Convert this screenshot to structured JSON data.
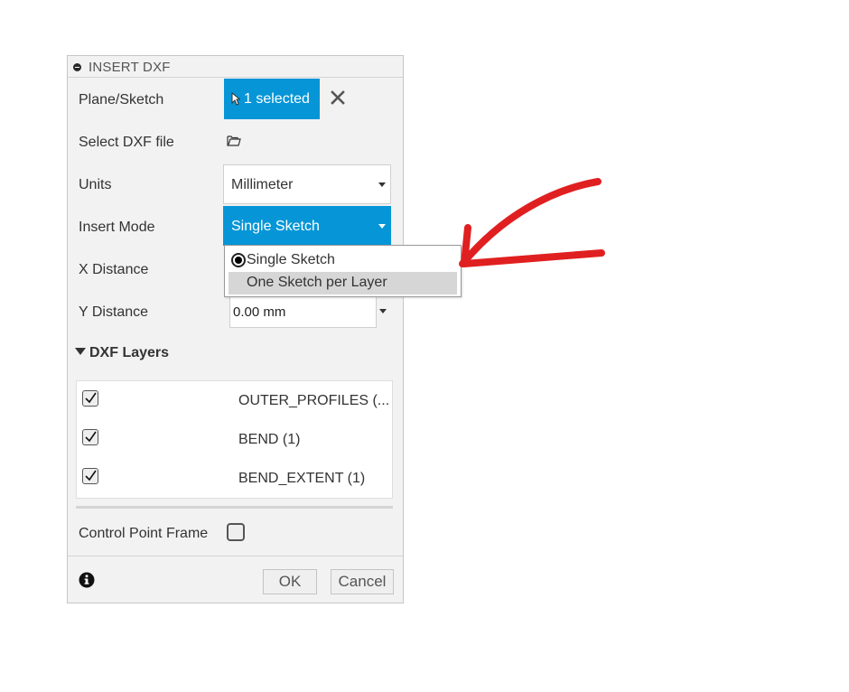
{
  "dialog": {
    "title": "INSERT DXF",
    "plane_sketch": {
      "label": "Plane/Sketch",
      "selection": "1 selected"
    },
    "dxf_file": {
      "label": "Select DXF file"
    },
    "units": {
      "label": "Units",
      "value": "Millimeter"
    },
    "insert_mode": {
      "label": "Insert Mode",
      "value": "Single Sketch",
      "options": [
        "Single Sketch",
        "One Sketch per Layer"
      ],
      "highlighted_option": "One Sketch per Layer"
    },
    "x_distance": {
      "label": "X Distance"
    },
    "y_distance": {
      "label": "Y Distance",
      "value": "0.00 mm"
    },
    "layers": {
      "header": "DXF Layers",
      "items": [
        {
          "name": "OUTER_PROFILES (...",
          "checked": true
        },
        {
          "name": "BEND (1)",
          "checked": true
        },
        {
          "name": "BEND_EXTENT (1)",
          "checked": true
        }
      ]
    },
    "control_point_frame": {
      "label": "Control Point Frame",
      "checked": false
    },
    "ok_label": "OK",
    "cancel_label": "Cancel"
  },
  "colors": {
    "accent": "#0696d7",
    "annotation_arrow": "#e02020",
    "dialog_bg": "#f2f2f2"
  },
  "icons": [
    "collapse-icon",
    "cursor-icon",
    "close-icon",
    "folder-open-icon",
    "chevron-down-icon",
    "checkbox-icon",
    "radio-icon",
    "info-icon",
    "annotation-arrow"
  ]
}
